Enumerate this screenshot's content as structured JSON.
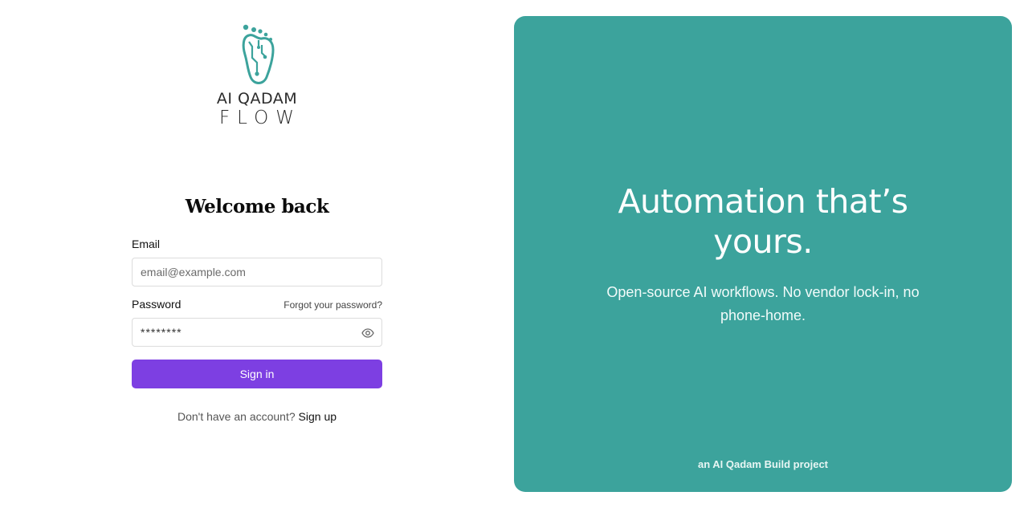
{
  "brand": {
    "name_line1": "AI QADAM",
    "name_line2": "FLOW",
    "logo_color": "#3ca39c"
  },
  "login": {
    "title": "Welcome back",
    "email_label": "Email",
    "email_placeholder": "email@example.com",
    "password_label": "Password",
    "forgot_link": "Forgot your password?",
    "password_value": "********",
    "signin_label": "Sign in",
    "no_account_text": "Don't have an account?",
    "signup_link": "Sign up",
    "button_color": "#7d3fe2"
  },
  "promo": {
    "headline_line1": "Automation that’s",
    "headline_line2": "yours.",
    "subline": "Open-source AI workflows. No vendor lock-in, no phone-home.",
    "footer_note": "an AI Qadam Build project",
    "panel_color": "#3ca39c"
  },
  "icons": {
    "logo": "foot-circuit-icon",
    "toggle_password": "eye-icon"
  }
}
